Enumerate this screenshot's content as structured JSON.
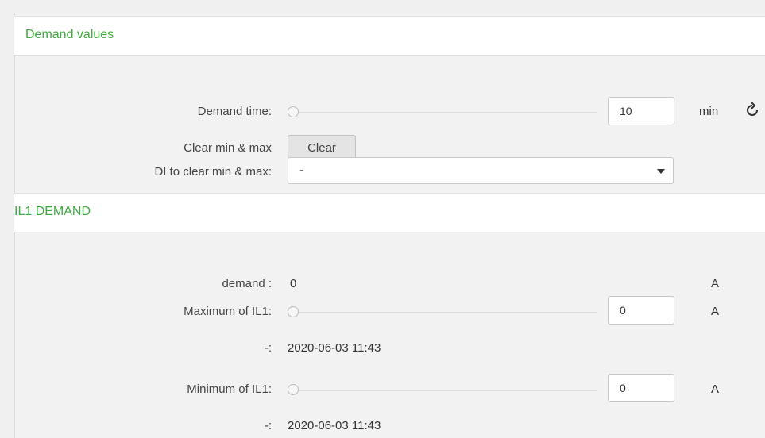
{
  "sections": [
    {
      "title": "Demand values",
      "rows": {
        "demand_time": {
          "label": "Demand time:",
          "value": "10",
          "unit": "min",
          "slider_level": 0
        },
        "clear": {
          "label": "Clear min & max",
          "button": "Clear"
        },
        "di_clear": {
          "label": "DI to clear min & max:",
          "selected": "-"
        }
      }
    },
    {
      "title": "IL1 DEMAND",
      "rows": {
        "demand": {
          "label": "demand :",
          "value": "0",
          "unit": "A"
        },
        "maximum": {
          "label": "Maximum of IL1:",
          "value": "0",
          "unit": "A",
          "slider_level": 0
        },
        "maximum_time": {
          "label": "-:",
          "value": "2020-06-03 11:43"
        },
        "minimum": {
          "label": "Minimum of IL1:",
          "value": "0",
          "unit": "A",
          "slider_level": 0
        },
        "minimum_time": {
          "label": "-:",
          "value": "2020-06-03 11:43"
        }
      }
    }
  ],
  "icons": {
    "reset": "reset-icon"
  },
  "colors": {
    "section_title": "#3dab3d"
  }
}
